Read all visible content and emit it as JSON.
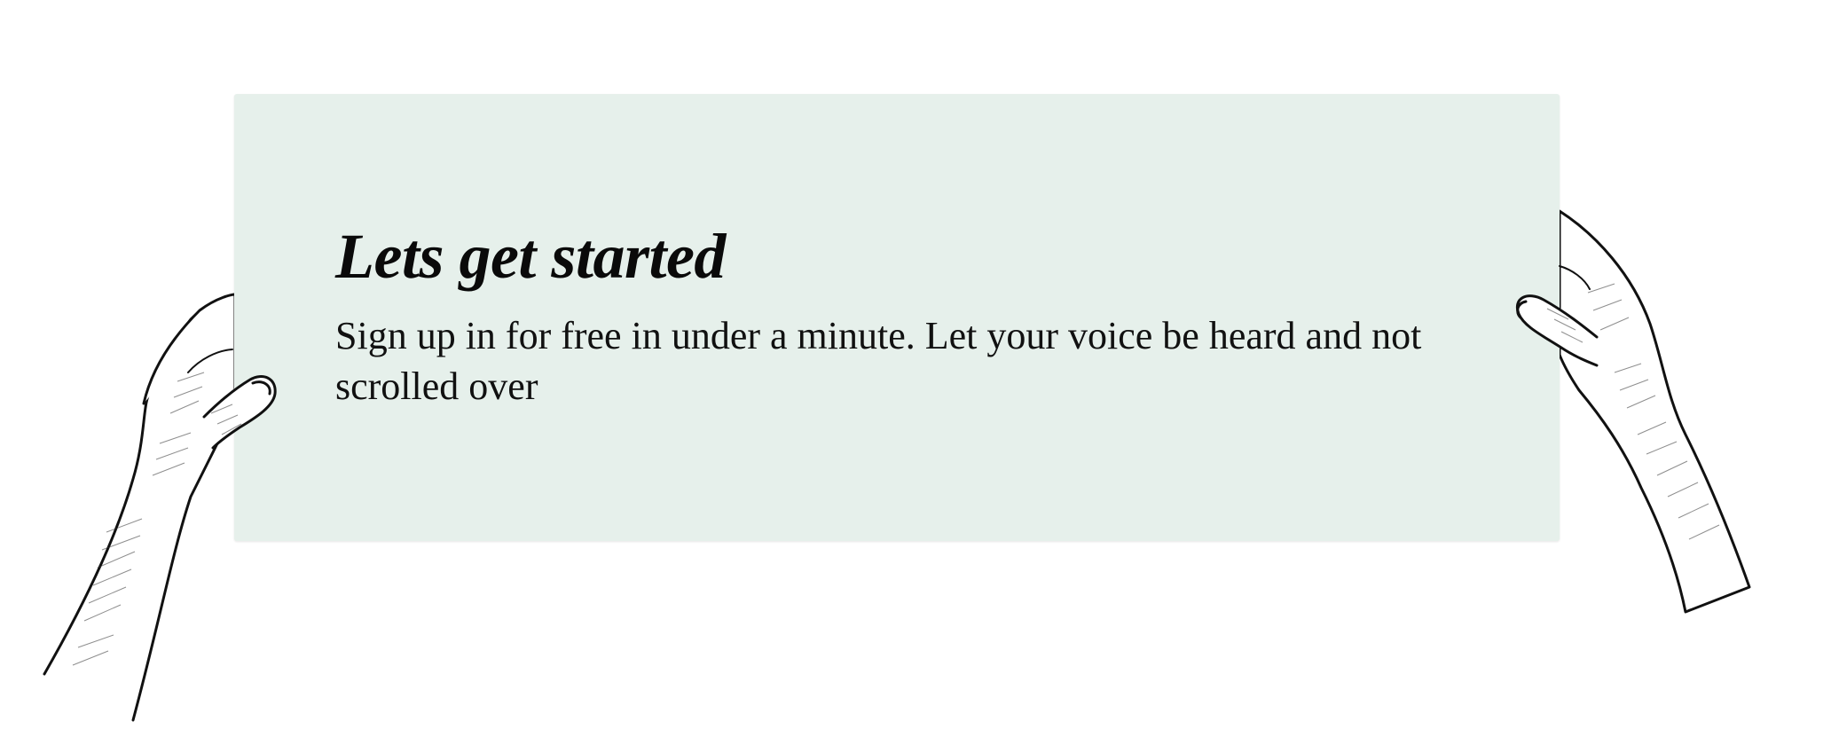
{
  "sign": {
    "title": "Lets get started",
    "description": "Sign up in for free in under a minute. Let your voice be heard and not scrolled over",
    "background_color": "#e6f0eb"
  },
  "illustration": {
    "left_hand_icon": "hand-holding-left-icon",
    "right_hand_icon": "hand-holding-right-icon"
  }
}
